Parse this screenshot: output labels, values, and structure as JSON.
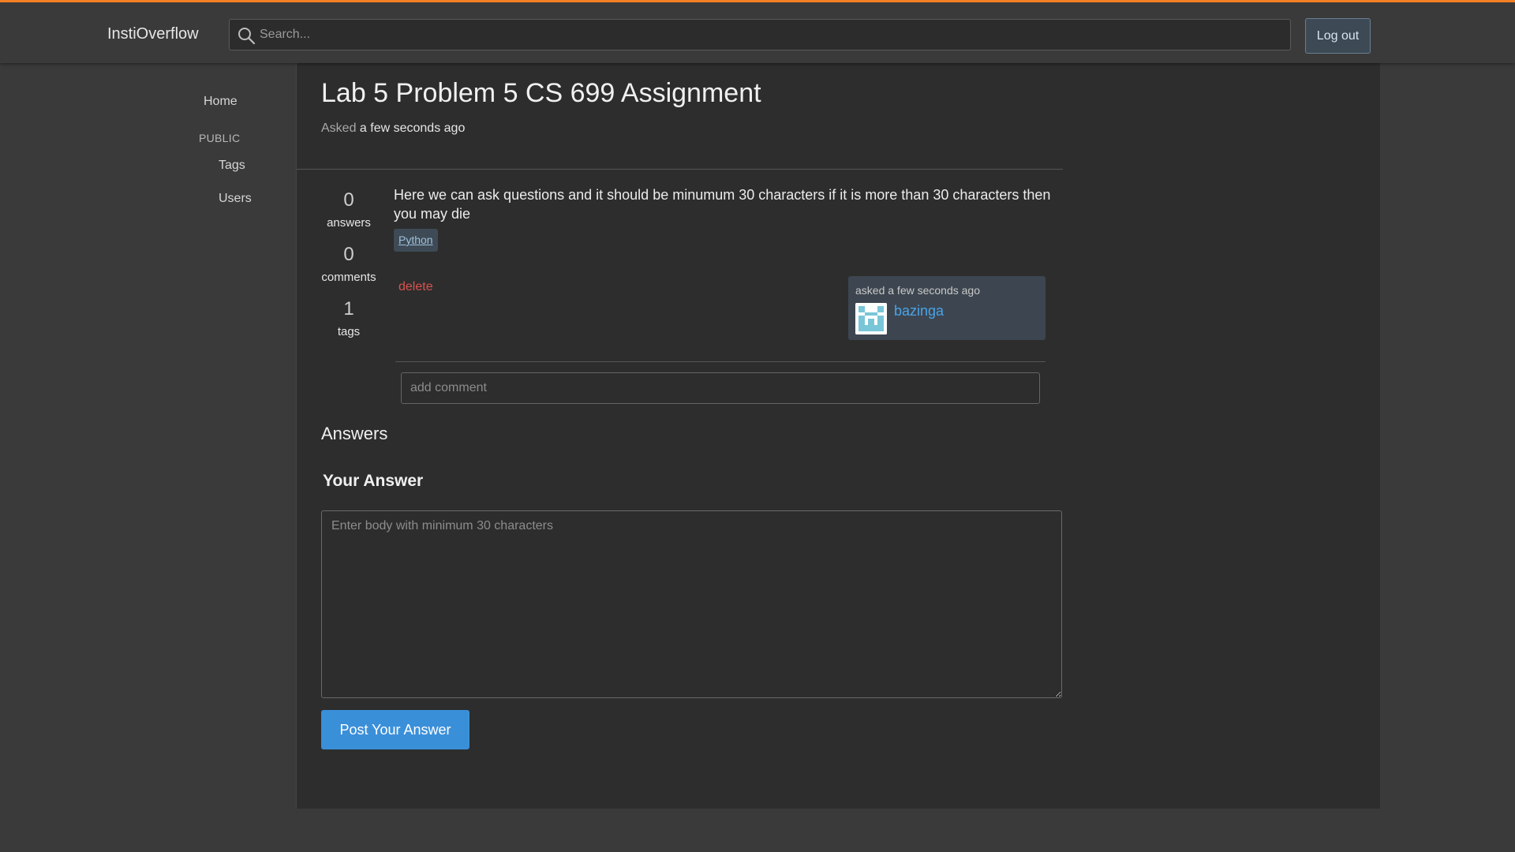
{
  "header": {
    "brand": "InstiOverflow",
    "search_placeholder": "Search...",
    "logout_label": "Log out",
    "accent_color": "#f48024"
  },
  "sidebar": {
    "home": "Home",
    "section": "PUBLIC",
    "tags": "Tags",
    "users": "Users"
  },
  "question": {
    "title": "Lab 5 Problem 5 CS 699 Assignment",
    "asked_label": "Asked",
    "asked_time": "a few seconds ago",
    "body": "Here we can ask questions and it should be minumum 30 characters if it is more than 30 characters then you may die",
    "tag": "Python",
    "delete_label": "delete",
    "stats": {
      "answers_count": "0",
      "answers_label": "answers",
      "comments_count": "0",
      "comments_label": "comments",
      "tags_count": "1",
      "tags_label": "tags"
    },
    "owner": {
      "asked_text": "asked a few seconds ago",
      "username": "bazinga",
      "avatar_icon": "identicon"
    },
    "comment_placeholder": "add comment"
  },
  "answers": {
    "heading": "Answers",
    "your_answer_heading": "Your Answer",
    "body_placeholder": "Enter body with minimum 30 characters",
    "post_label": "Post Your Answer",
    "button_color": "#3a8fd9"
  }
}
